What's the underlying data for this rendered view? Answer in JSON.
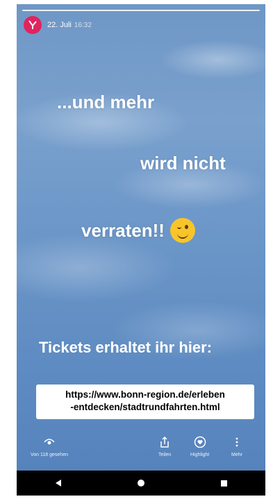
{
  "story": {
    "date": "22. Juli",
    "time": "16:32",
    "lines": [
      "...und mehr",
      "wird nicht",
      "verraten!!"
    ],
    "emoji": "winking-face",
    "tickets_heading": "Tickets erhaltet ihr hier:",
    "url_line1": "https://www.bonn-region.de/erleben",
    "url_line2": "-entdecken/stadtrundfahrten.html"
  },
  "actions": {
    "seen": "Von 118 gesehen",
    "share": "Teilen",
    "highlight": "Highlight",
    "more": "Mehr"
  },
  "colors": {
    "avatar": "#e0245e",
    "sky": "#6f97c6"
  }
}
